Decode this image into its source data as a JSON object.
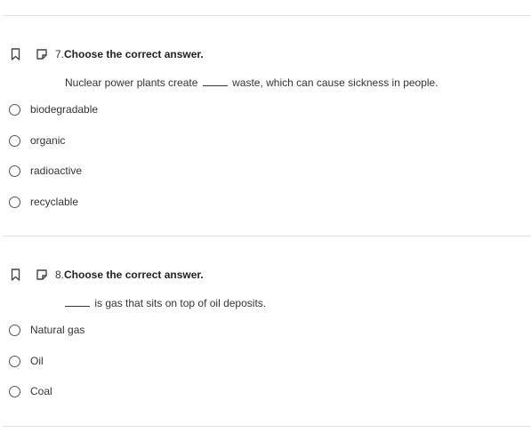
{
  "questions": [
    {
      "number": "7.",
      "title": "Choose the correct answer.",
      "text_before": "Nuclear power plants create",
      "text_after": "waste, which can cause sickness in people.",
      "options": [
        "biodegradable",
        "organic",
        "radioactive",
        "recyclable"
      ]
    },
    {
      "number": "8.",
      "title": "Choose the correct answer.",
      "text_before": "",
      "text_after": "is gas that sits on top of oil deposits.",
      "options": [
        "Natural gas",
        "Oil",
        "Coal"
      ]
    }
  ],
  "icons": {
    "bookmark": "bookmark-icon",
    "note": "note-icon"
  },
  "colors": {
    "divider": "#e2e2e2",
    "text": "#333333",
    "radio_border": "#555555"
  }
}
